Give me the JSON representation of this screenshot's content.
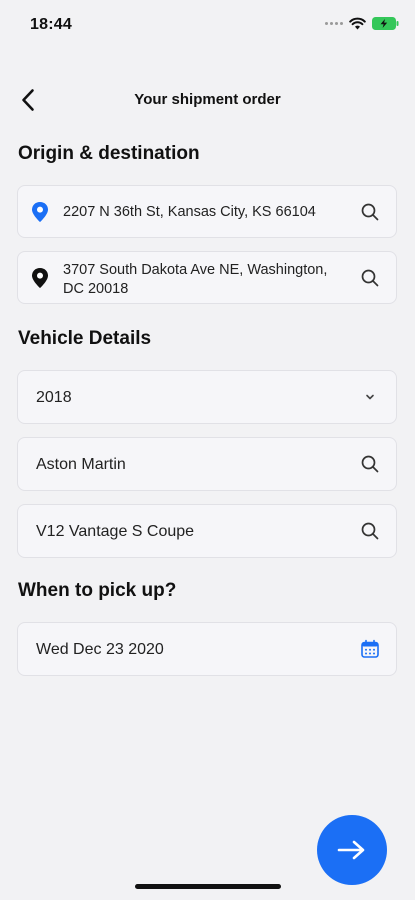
{
  "status_bar": {
    "time": "18:44"
  },
  "nav": {
    "title": "Your shipment order"
  },
  "origin_section": {
    "title": "Origin & destination",
    "origin_value": "2207 N 36th St, Kansas City, KS 66104",
    "destination_line1": "3707 South Dakota Ave NE, Washington,",
    "destination_line2": "DC 20018"
  },
  "vehicle_section": {
    "title": "Vehicle Details",
    "year": "2018",
    "make": "Aston Martin",
    "model": "V12 Vantage S Coupe"
  },
  "pickup_section": {
    "title": "When to pick up?",
    "date": "Wed Dec 23 2020"
  },
  "colors": {
    "accent": "#1b6ff5",
    "background": "#f2f2f4",
    "field_bg": "#f6f6f9",
    "battery": "#34c759"
  },
  "icons": {
    "back": "chevron-left-icon",
    "origin_pin": "location-pin-icon",
    "destination_pin": "location-pin-icon",
    "search": "search-icon",
    "dropdown": "chevron-down-icon",
    "calendar": "calendar-icon",
    "next": "arrow-right-icon"
  }
}
